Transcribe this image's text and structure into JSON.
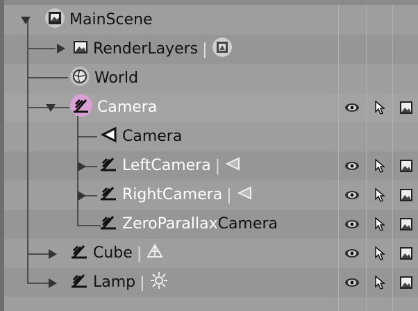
{
  "colors": {
    "background": "#999999",
    "row_light": "#9e9e9e",
    "row_dark": "#969696",
    "selected_text": "#ffffff",
    "selected_highlight": "#d9a0d4"
  },
  "rows": [
    {
      "label": "MainScene",
      "icon": "scene-icon"
    },
    {
      "label": "RenderLayers",
      "icon": "render-layers-icon",
      "extra_icon": "render-layer-sub-icon"
    },
    {
      "label": "World",
      "icon": "world-icon"
    },
    {
      "label": "Camera",
      "icon": "object-axis-icon",
      "selected": true
    },
    {
      "label": "Camera",
      "icon": "camera-data-icon"
    },
    {
      "label": "LeftCamera",
      "icon": "object-axis-icon",
      "extra_icon": "camera-data-icon"
    },
    {
      "label": "RightCamera",
      "icon": "object-axis-icon",
      "extra_icon": "camera-data-icon"
    },
    {
      "label_prefix": "ZeroParallax",
      "label_suffix": "Camera",
      "icon": "object-axis-icon"
    },
    {
      "label": "Cube",
      "icon": "object-axis-icon",
      "extra_icon": "mesh-icon"
    },
    {
      "label": "Lamp",
      "icon": "object-axis-icon",
      "extra_icon": "lamp-icon"
    }
  ],
  "restrict_columns": [
    "eye-icon",
    "cursor-icon",
    "render-icon"
  ],
  "separator": "|"
}
